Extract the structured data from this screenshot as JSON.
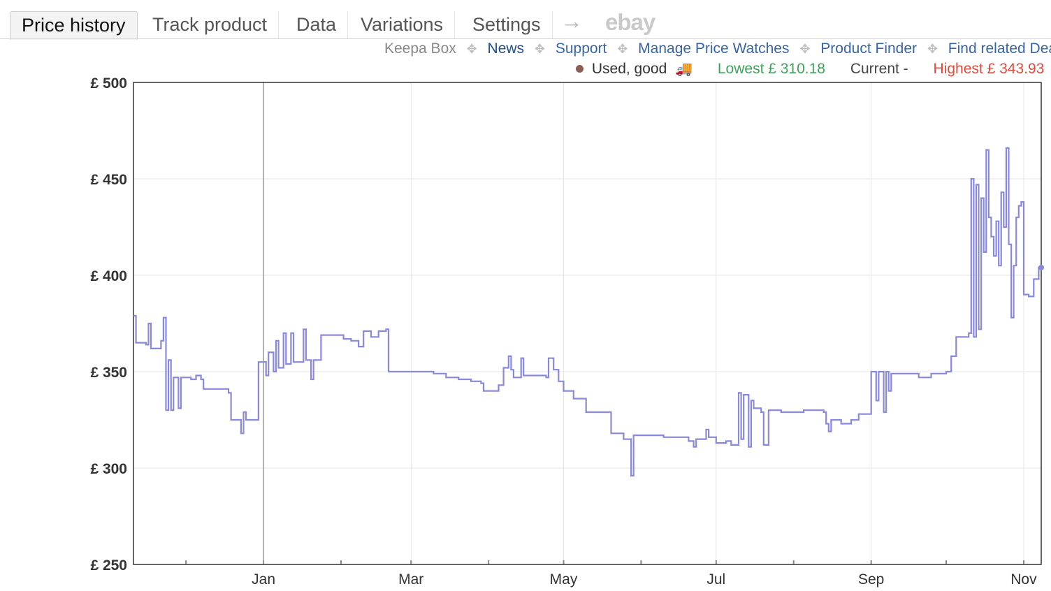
{
  "tabs": [
    {
      "label": "Price history",
      "active": true
    },
    {
      "label": "Track product",
      "active": false
    },
    {
      "label": "Data",
      "active": false
    },
    {
      "label": "Variations",
      "active": false
    },
    {
      "label": "Settings",
      "active": false
    }
  ],
  "arrow_glyph": "→",
  "ebay_label": "ebay",
  "links": [
    "Keepa Box",
    "News",
    "Support",
    "Manage Price Watches",
    "Product Finder",
    "Find related Dea"
  ],
  "legend": {
    "series_label": "Used, good",
    "lowest": "Lowest £ 310.18",
    "current": "Current -",
    "highest": "Highest £ 343.93",
    "colors": {
      "series": "#8888dd",
      "lowest": "#3ea35b",
      "highest": "#e5493b",
      "dot": "#8b5e52"
    }
  },
  "chart_data": {
    "type": "line",
    "ylim": [
      250,
      500
    ],
    "yticks": [
      500,
      450,
      400,
      350,
      300,
      250
    ],
    "ytick_labels": [
      "£ 500",
      "£ 450",
      "£ 400",
      "£ 350",
      "£ 300",
      "£ 250"
    ],
    "xlim": [
      "2022-11-10",
      "2023-11-08"
    ],
    "xticks": [
      {
        "date": "2023-01-01",
        "label": "Jan"
      },
      {
        "date": "2023-03-01",
        "label": "Mar"
      },
      {
        "date": "2023-05-01",
        "label": "May"
      },
      {
        "date": "2023-07-01",
        "label": "Jul"
      },
      {
        "date": "2023-09-01",
        "label": "Sep"
      },
      {
        "date": "2023-11-01",
        "label": "Nov"
      }
    ],
    "minor_ticks": [
      "2022-12-01",
      "2023-02-01",
      "2023-04-01",
      "2023-06-01",
      "2023-08-01",
      "2023-10-01"
    ],
    "marker_line_date": "2023-01-01",
    "grid": true,
    "series": [
      {
        "color": "#8888dd",
        "points": [
          [
            "2022-11-10",
            379
          ],
          [
            "2022-11-11",
            365
          ],
          [
            "2022-11-15",
            364
          ],
          [
            "2022-11-16",
            375
          ],
          [
            "2022-11-17",
            362
          ],
          [
            "2022-11-21",
            366
          ],
          [
            "2022-11-22",
            378
          ],
          [
            "2022-11-23",
            330
          ],
          [
            "2022-11-24",
            356
          ],
          [
            "2022-11-25",
            330
          ],
          [
            "2022-11-26",
            347
          ],
          [
            "2022-11-28",
            331
          ],
          [
            "2022-11-29",
            347
          ],
          [
            "2022-12-03",
            346
          ],
          [
            "2022-12-05",
            348
          ],
          [
            "2022-12-07",
            346
          ],
          [
            "2022-12-08",
            341
          ],
          [
            "2022-12-18",
            339
          ],
          [
            "2022-12-19",
            325
          ],
          [
            "2022-12-23",
            318
          ],
          [
            "2022-12-24",
            329
          ],
          [
            "2022-12-25",
            325
          ],
          [
            "2022-12-30",
            355
          ],
          [
            "2023-01-02",
            348
          ],
          [
            "2023-01-03",
            360
          ],
          [
            "2023-01-05",
            350
          ],
          [
            "2023-01-06",
            366
          ],
          [
            "2023-01-07",
            352
          ],
          [
            "2023-01-09",
            370
          ],
          [
            "2023-01-10",
            354
          ],
          [
            "2023-01-12",
            370
          ],
          [
            "2023-01-13",
            355
          ],
          [
            "2023-01-17",
            372
          ],
          [
            "2023-01-18",
            356
          ],
          [
            "2023-01-20",
            346
          ],
          [
            "2023-01-21",
            356
          ],
          [
            "2023-01-24",
            369
          ],
          [
            "2023-02-02",
            367
          ],
          [
            "2023-02-05",
            366
          ],
          [
            "2023-02-08",
            363
          ],
          [
            "2023-02-10",
            371
          ],
          [
            "2023-02-13",
            368
          ],
          [
            "2023-02-16",
            371
          ],
          [
            "2023-02-19",
            372
          ],
          [
            "2023-02-20",
            350
          ],
          [
            "2023-03-10",
            349
          ],
          [
            "2023-03-15",
            347
          ],
          [
            "2023-03-20",
            346
          ],
          [
            "2023-03-25",
            345
          ],
          [
            "2023-03-29",
            344
          ],
          [
            "2023-03-30",
            340
          ],
          [
            "2023-04-05",
            343
          ],
          [
            "2023-04-07",
            352
          ],
          [
            "2023-04-09",
            358
          ],
          [
            "2023-04-10",
            351
          ],
          [
            "2023-04-11",
            347
          ],
          [
            "2023-04-14",
            357
          ],
          [
            "2023-04-15",
            348
          ],
          [
            "2023-04-24",
            347
          ],
          [
            "2023-04-25",
            357
          ],
          [
            "2023-04-27",
            351
          ],
          [
            "2023-04-29",
            345
          ],
          [
            "2023-05-01",
            340
          ],
          [
            "2023-05-05",
            336
          ],
          [
            "2023-05-10",
            329
          ],
          [
            "2023-05-20",
            318
          ],
          [
            "2023-05-25",
            315
          ],
          [
            "2023-05-28",
            296
          ],
          [
            "2023-05-29",
            317
          ],
          [
            "2023-06-10",
            316
          ],
          [
            "2023-06-20",
            314
          ],
          [
            "2023-06-22",
            311
          ],
          [
            "2023-06-23",
            315
          ],
          [
            "2023-06-27",
            320
          ],
          [
            "2023-06-28",
            316
          ],
          [
            "2023-07-01",
            313
          ],
          [
            "2023-07-05",
            314
          ],
          [
            "2023-07-07",
            312
          ],
          [
            "2023-07-10",
            339
          ],
          [
            "2023-07-11",
            315
          ],
          [
            "2023-07-12",
            338
          ],
          [
            "2023-07-14",
            311
          ],
          [
            "2023-07-15",
            335
          ],
          [
            "2023-07-16",
            331
          ],
          [
            "2023-07-19",
            329
          ],
          [
            "2023-07-20",
            312
          ],
          [
            "2023-07-22",
            330
          ],
          [
            "2023-07-27",
            329
          ],
          [
            "2023-08-05",
            330
          ],
          [
            "2023-08-13",
            329
          ],
          [
            "2023-08-14",
            323
          ],
          [
            "2023-08-15",
            319
          ],
          [
            "2023-08-16",
            325
          ],
          [
            "2023-08-20",
            323
          ],
          [
            "2023-08-24",
            325
          ],
          [
            "2023-08-27",
            328
          ],
          [
            "2023-09-01",
            350
          ],
          [
            "2023-09-03",
            335
          ],
          [
            "2023-09-04",
            350
          ],
          [
            "2023-09-06",
            329
          ],
          [
            "2023-09-07",
            350
          ],
          [
            "2023-09-08",
            340
          ],
          [
            "2023-09-09",
            349
          ],
          [
            "2023-09-20",
            347
          ],
          [
            "2023-09-25",
            349
          ],
          [
            "2023-10-01",
            350
          ],
          [
            "2023-10-03",
            358
          ],
          [
            "2023-10-05",
            368
          ],
          [
            "2023-10-10",
            370
          ],
          [
            "2023-10-11",
            450
          ],
          [
            "2023-10-12",
            368
          ],
          [
            "2023-10-13",
            447
          ],
          [
            "2023-10-14",
            372
          ],
          [
            "2023-10-15",
            440
          ],
          [
            "2023-10-16",
            412
          ],
          [
            "2023-10-17",
            465
          ],
          [
            "2023-10-18",
            430
          ],
          [
            "2023-10-19",
            420
          ],
          [
            "2023-10-20",
            410
          ],
          [
            "2023-10-21",
            428
          ],
          [
            "2023-10-22",
            405
          ],
          [
            "2023-10-23",
            443
          ],
          [
            "2023-10-24",
            425
          ],
          [
            "2023-10-25",
            466
          ],
          [
            "2023-10-26",
            416
          ],
          [
            "2023-10-27",
            378
          ],
          [
            "2023-10-28",
            405
          ],
          [
            "2023-10-29",
            430
          ],
          [
            "2023-10-30",
            436
          ],
          [
            "2023-10-31",
            438
          ],
          [
            "2023-11-01",
            390
          ],
          [
            "2023-11-03",
            389
          ],
          [
            "2023-11-05",
            398
          ],
          [
            "2023-11-07",
            404
          ],
          [
            "2023-11-08",
            404
          ]
        ]
      }
    ]
  }
}
